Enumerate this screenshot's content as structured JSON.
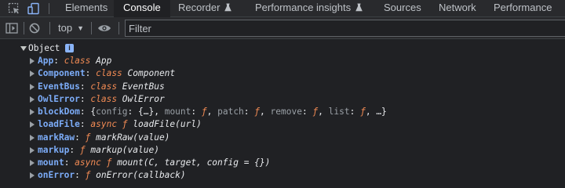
{
  "tabbar": {
    "tabs": [
      {
        "label": "Elements",
        "active": false
      },
      {
        "label": "Console",
        "active": true
      },
      {
        "label": "Recorder",
        "active": false,
        "experimental_icon": "flask-icon"
      },
      {
        "label": "Performance insights",
        "active": false,
        "experimental_icon": "flask-icon"
      },
      {
        "label": "Sources",
        "active": false
      },
      {
        "label": "Network",
        "active": false
      },
      {
        "label": "Performance",
        "active": false
      }
    ]
  },
  "toolbar": {
    "context": "top",
    "filter_placeholder": "Filter"
  },
  "console": {
    "object_label": "Object",
    "info_badge": "i",
    "properties": [
      {
        "key": "App",
        "parts": [
          [
            "kw",
            "class"
          ],
          [
            "sig",
            " App"
          ]
        ]
      },
      {
        "key": "Component",
        "parts": [
          [
            "kw",
            "class"
          ],
          [
            "sig",
            " Component"
          ]
        ]
      },
      {
        "key": "EventBus",
        "parts": [
          [
            "kw",
            "class"
          ],
          [
            "sig",
            " EventBus"
          ]
        ]
      },
      {
        "key": "OwlError",
        "parts": [
          [
            "kw",
            "class"
          ],
          [
            "sig",
            " OwlError"
          ]
        ]
      },
      {
        "key": "blockDom",
        "parts": [
          [
            "val",
            "{"
          ],
          [
            "dim",
            "config"
          ],
          [
            "val",
            ": {…}, "
          ],
          [
            "dim",
            "mount"
          ],
          [
            "val",
            ": "
          ],
          [
            "kw",
            "ƒ"
          ],
          [
            "val",
            ", "
          ],
          [
            "dim",
            "patch"
          ],
          [
            "val",
            ": "
          ],
          [
            "kw",
            "ƒ"
          ],
          [
            "val",
            ", "
          ],
          [
            "dim",
            "remove"
          ],
          [
            "val",
            ": "
          ],
          [
            "kw",
            "ƒ"
          ],
          [
            "val",
            ", "
          ],
          [
            "dim",
            "list"
          ],
          [
            "val",
            ": "
          ],
          [
            "kw",
            "ƒ"
          ],
          [
            "val",
            ", …}"
          ]
        ]
      },
      {
        "key": "loadFile",
        "parts": [
          [
            "kw",
            "async ƒ"
          ],
          [
            "sig",
            " loadFile(url)"
          ]
        ]
      },
      {
        "key": "markRaw",
        "parts": [
          [
            "kw",
            "ƒ"
          ],
          [
            "sig",
            " markRaw(value)"
          ]
        ]
      },
      {
        "key": "markup",
        "parts": [
          [
            "kw",
            "ƒ"
          ],
          [
            "sig",
            " markup(value)"
          ]
        ]
      },
      {
        "key": "mount",
        "parts": [
          [
            "kw",
            "async ƒ"
          ],
          [
            "sig",
            " mount(C, target, config = {})"
          ]
        ]
      },
      {
        "key": "onError",
        "parts": [
          [
            "kw",
            "ƒ"
          ],
          [
            "sig",
            " onError(callback)"
          ]
        ]
      }
    ]
  },
  "colors": {
    "panel_bg": "#202124",
    "toolbar_bg": "#292a2d",
    "key_blue": "#7cacf8",
    "keyword_orange": "#f28b54",
    "info_badge_blue": "#8ab4f8"
  }
}
